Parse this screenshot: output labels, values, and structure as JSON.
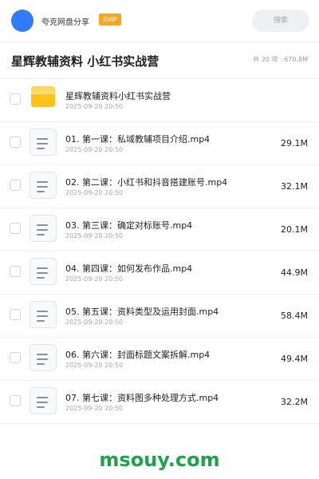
{
  "app": {
    "name": "夸克网盘分享",
    "badge": "SVIP",
    "search_label": "搜索"
  },
  "folder": {
    "title": "星辉教辅资料 小红书实战营",
    "summary": "共 20 项 · 670.8M"
  },
  "items": [
    {
      "type": "folder",
      "name": "星辉教辅资料小红书实战营",
      "date": "2025-09-20 20:50",
      "size": ""
    },
    {
      "type": "file",
      "name": "01. 第一课：私域教辅项目介绍.mp4",
      "date": "2025-09-20 20:50",
      "size": "29.1M"
    },
    {
      "type": "file",
      "name": "02. 第二课：小红书和抖音搭建账号.mp4",
      "date": "2025-09-20 20:50",
      "size": "32.1M"
    },
    {
      "type": "file",
      "name": "03. 第三课：确定对标账号.mp4",
      "date": "2025-09-20 20:50",
      "size": "20.1M"
    },
    {
      "type": "file",
      "name": "04. 第四课：如何发布作品.mp4",
      "date": "2025-09-20 20:50",
      "size": "44.9M"
    },
    {
      "type": "file",
      "name": "05. 第五课：资料类型及运用封面.mp4",
      "date": "2025-09-20 20:50",
      "size": "58.4M"
    },
    {
      "type": "file",
      "name": "06. 第六课：封面标题文案拆解.mp4",
      "date": "2025-09-20 20:50",
      "size": "49.4M"
    },
    {
      "type": "file",
      "name": "07. 第七课：资料图多种处理方式.mp4",
      "date": "2025-09-20 20:50",
      "size": "32.2M"
    }
  ],
  "watermark": "msouy.com",
  "colors": {
    "accent": "#2f7cf6",
    "badge": "#f5a623",
    "folder": "#ffc21a",
    "watermark": "#1aa34a"
  }
}
